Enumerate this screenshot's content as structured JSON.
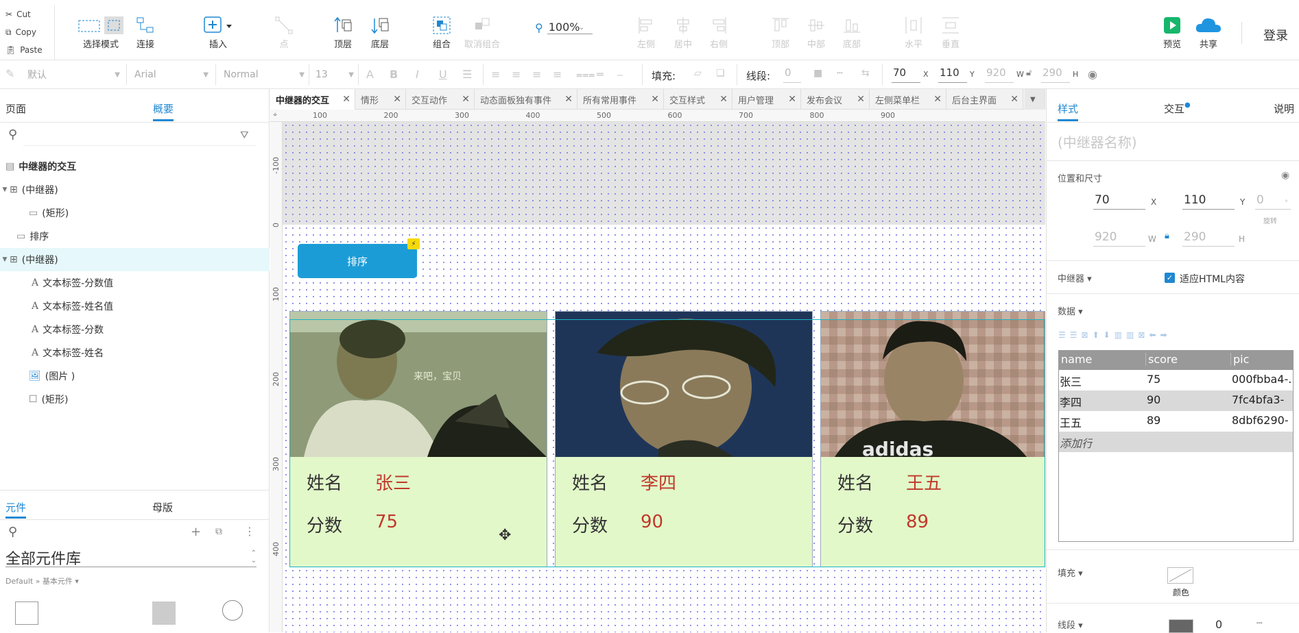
{
  "clipboard": {
    "cut": "Cut",
    "copy": "Copy",
    "paste": "Paste"
  },
  "toolbar": {
    "select_mode": "选择模式",
    "connect": "连接",
    "insert": "插入",
    "point": "点",
    "top_layer": "顶层",
    "bottom_layer": "底层",
    "group": "组合",
    "ungroup": "取消组合",
    "zoom": "100%",
    "align_left": "左侧",
    "align_center": "居中",
    "align_right": "右侧",
    "align_top": "顶部",
    "align_middle": "中部",
    "align_bottom": "底部",
    "dist_h": "水平",
    "dist_v": "垂直",
    "preview": "预览",
    "share": "共享",
    "login": "登录"
  },
  "format_bar": {
    "style": "默认",
    "font": "Arial",
    "weight": "Normal",
    "size": "13",
    "fill_label": "填充:",
    "stroke_label": "线段:",
    "stroke_value": "0",
    "x": "70",
    "y": "110",
    "w": "920",
    "h": "290",
    "x_unit": "X",
    "y_unit": "Y",
    "w_unit": "W",
    "h_unit": "H"
  },
  "left_panel": {
    "tab_pages": "页面",
    "tab_outline": "概要",
    "tree": [
      {
        "label": "中继器的交互",
        "bold": true
      },
      {
        "label": "(中继器)"
      },
      {
        "label": "(矩形)"
      },
      {
        "label": "排序"
      },
      {
        "label": "(中继器)"
      },
      {
        "label": "文本标签-分数值"
      },
      {
        "label": "文本标签-姓名值"
      },
      {
        "label": "文本标签-分数"
      },
      {
        "label": "文本标签-姓名"
      },
      {
        "label": "(图片 )"
      },
      {
        "label": "(矩形)"
      }
    ],
    "tab_widgets": "元件",
    "tab_masters": "母版",
    "library": "全部元件库",
    "library_path": "Default » 基本元件 ▾"
  },
  "canvas": {
    "tabs": [
      "中继器的交互",
      "情形",
      "交互动作",
      "动态面板独有事件",
      "所有常用事件",
      "交互样式",
      "用户管理",
      "发布会议",
      "左侧菜单栏",
      "后台主界面"
    ],
    "ruler_h": [
      "100",
      "200",
      "300",
      "400",
      "500",
      "600",
      "700",
      "800",
      "900"
    ],
    "ruler_v": [
      "-100",
      "0",
      "100",
      "200",
      "300",
      "400"
    ],
    "sort_button": "排序",
    "photo_caption": "来吧，宝贝",
    "name_label": "姓名",
    "score_label": "分数",
    "cards": [
      {
        "name": "张三",
        "score": "75"
      },
      {
        "name": "李四",
        "score": "90"
      },
      {
        "name": "王五",
        "score": "89"
      }
    ]
  },
  "right_panel": {
    "tab_style": "样式",
    "tab_interact": "交互",
    "tab_notes": "说明",
    "repeater_name_placeholder": "(中继器名称)",
    "pos_size": "位置和尺寸",
    "x": "70",
    "y": "110",
    "rotate": "0",
    "rotate_unit": "°",
    "rotate_label": "旋转",
    "w": "920",
    "h": "290",
    "repeater_label": "中继器 ▾",
    "fit_html": "适应HTML内容",
    "data_label": "数据 ▾",
    "table": {
      "headers": [
        "name",
        "score",
        "pic"
      ],
      "rows": [
        [
          "张三",
          "75",
          "000fbba4-."
        ],
        [
          "李四",
          "90",
          "7fc4bfa3-"
        ],
        [
          "王五",
          "89",
          "8dbf6290-"
        ]
      ],
      "add_row": "添加行"
    },
    "fill_label": "填充 ▾",
    "color_label": "颜色",
    "stroke_label": "线段 ▾",
    "stroke_value": "0"
  }
}
